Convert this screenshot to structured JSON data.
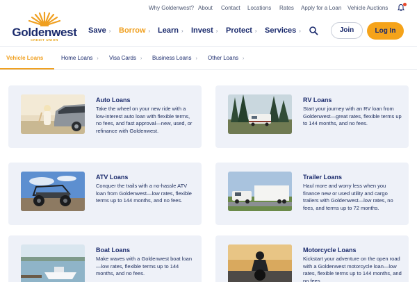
{
  "utility_nav": [
    "Why Goldenwest?",
    "About",
    "Contact",
    "Locations",
    "Rates",
    "Apply for a Loan",
    "Vehicle Auctions"
  ],
  "logo": {
    "name": "Goldenwest",
    "sub": "CREDIT UNION"
  },
  "main_nav": [
    "Save",
    "Borrow",
    "Learn",
    "Invest",
    "Protect",
    "Services"
  ],
  "buttons": {
    "join": "Join",
    "login": "Log In"
  },
  "sub_nav": [
    "Vehicle Loans",
    "Home Loans",
    "Visa Cards",
    "Business Loans",
    "Other Loans"
  ],
  "cards": [
    {
      "title": "Auto Loans",
      "desc": "Take the wheel on your new ride with a low-interest auto loan with flexible terms, no fees, and fast approval—new, used, or refinance with Goldenwest."
    },
    {
      "title": "RV Loans",
      "desc": "Start your journey with an RV loan from Goldenwest—great rates, flexible terms up to 144 months, and no fees."
    },
    {
      "title": "ATV Loans",
      "desc": "Conquer the trails with a no-hassle ATV loan from Goldenwest—low rates, flexible terms up to 144 months, and no fees."
    },
    {
      "title": "Trailer Loans",
      "desc": "Haul more and worry less when you finance new or used utility and cargo trailers with Goldenwest—low rates, no fees, and terms up to 72 months."
    },
    {
      "title": "Boat Loans",
      "desc": "Make waves with a Goldenwest boat loan—low rates, flexible terms up to 144 months, and no fees."
    },
    {
      "title": "Motorcycle Loans",
      "desc": "Kickstart your adventure on the open road with a Goldenwest motorcycle loan—low rates, flexible terms up to 144 months, and no fees."
    }
  ],
  "colors": {
    "navy": "#1a2a6c",
    "gold": "#f5a31a",
    "card_bg": "#eef1f8"
  },
  "icons": [
    "bell-icon",
    "search-icon",
    "chevron-right-icon"
  ]
}
